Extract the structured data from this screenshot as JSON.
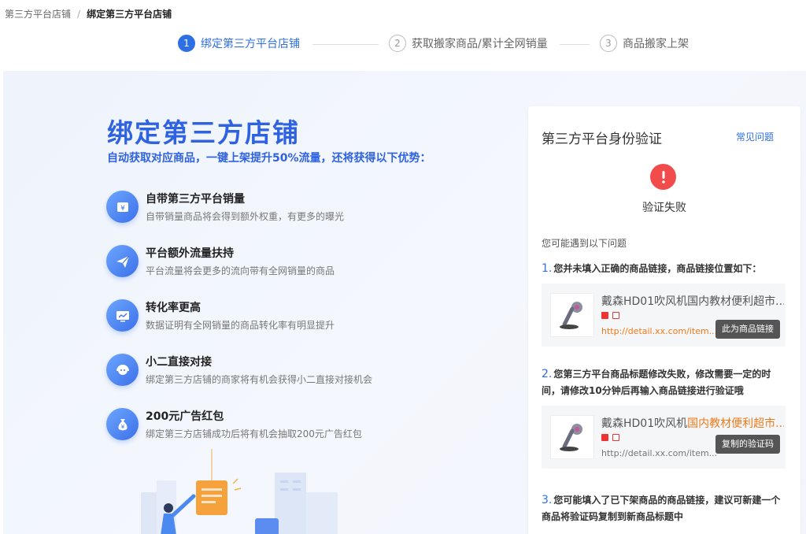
{
  "breadcrumb": {
    "parent": "第三方平台店铺",
    "separator": "/",
    "current": "绑定第三方平台店铺"
  },
  "steps": [
    {
      "num": "1",
      "label": "绑定第三方平台店铺",
      "active": true
    },
    {
      "num": "2",
      "label": "获取搬家商品/累计全网销量",
      "active": false
    },
    {
      "num": "3",
      "label": "商品搬家上架",
      "active": false
    }
  ],
  "hero": {
    "title": "绑定第三方店铺",
    "subtitle": "自动获取对应商品，一键上架提升50%流量，还将获得以下优势："
  },
  "features": [
    {
      "icon": "wallet-icon",
      "title": "自带第三方平台销量",
      "desc": "自带销量商品将会得到额外权重，有更多的曝光"
    },
    {
      "icon": "paper-plane-icon",
      "title": "平台额外流量扶持",
      "desc": "平台流量将会更多的流向带有全网销量的商品"
    },
    {
      "icon": "chart-screen-icon",
      "title": "转化率更高",
      "desc": "数据证明有全网销量的商品转化率有明显提升"
    },
    {
      "icon": "headset-icon",
      "title": "小二直接对接",
      "desc": "绑定第三方店铺的商家将有机会获得小二直接对接机会"
    },
    {
      "icon": "money-bag-icon",
      "title": "200元广告红包",
      "desc": "绑定第三方店铺成功后将有机会抽取200元广告红包"
    }
  ],
  "verify": {
    "title": "第三方平台身份验证",
    "faq_link": "常见问题",
    "status": "验证失败",
    "hint": "您可能遇到以下问题",
    "issues": [
      {
        "num": "1.",
        "text": "您并未填入正确的商品链接，商品链接位置如下："
      },
      {
        "num": "2.",
        "text": "您第三方平台商品标题修改失败，修改需要一定的时间，请修改10分钟后再输入商品链接进行验证哦"
      },
      {
        "num": "3.",
        "text": "您可能填入了已下架商品的商品链接，建议可新建一个商品将验证码复制到新商品标题中"
      }
    ],
    "card1": {
      "title": "戴森HD01吹风机国内教材便利超市...",
      "url": "http://detail.xx.com/item...",
      "tip": "此为商品链接"
    },
    "card2": {
      "title_plain": "戴森HD01吹风机",
      "title_highlight": "国内教材便利超市...",
      "url": "http://detail.xx.com/item...",
      "tip": "复制的验证码"
    }
  },
  "colors": {
    "primary": "#2f6fe4",
    "error": "#f24b4b",
    "highlight": "#f07a1a"
  }
}
